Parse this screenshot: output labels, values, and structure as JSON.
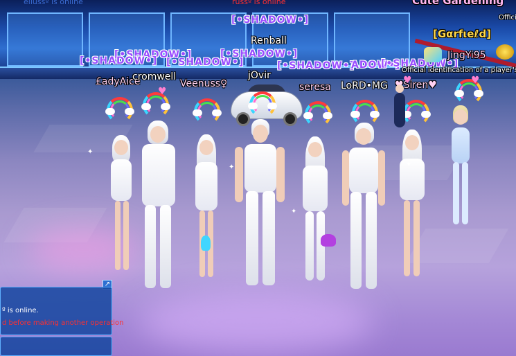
{
  "top_notices": {
    "left_text": "ellussº is online",
    "center_text": "russº is online",
    "corner_logo": "Cute Gardening",
    "corner_right": "Offici"
  },
  "labels": {
    "guild_tag": "[•SHADOW•]",
    "guild_tag_partial": "ADOW•]",
    "players": {
      "p1": "£adyAice",
      "p2": "cromwell",
      "p3": "Veenuss♀",
      "p4": "Renball",
      "p5": "jOvir",
      "p6": "seresa",
      "p7": "LoRD•MG",
      "p8": "♥Siren♥",
      "p9": "JingYi95",
      "p10": "[Gαrfιeℓd]",
      "p11": "Official identification of a player's ge"
    }
  },
  "chat": {
    "line1": "º is online.",
    "line2": "d before making another operation",
    "resize_icon": "↗"
  },
  "colors": {
    "guild": "#9a4dff",
    "gold": "#ffd84a",
    "system_red": "#ff3030",
    "chat_bg": "#1446a0"
  }
}
